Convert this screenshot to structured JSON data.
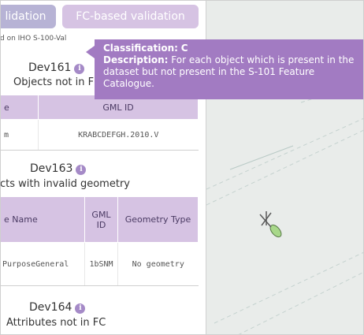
{
  "tabs": {
    "left_label": "lidation",
    "right_label": "FC-based validation"
  },
  "based_on": "d on IHO S-100-Val",
  "dev161": {
    "code": "Dev161",
    "subtitle": "Objects not in F",
    "headers": [
      "e",
      "GML ID"
    ],
    "rows": [
      [
        "m",
        "KRABCDEFGH.2010.V"
      ]
    ]
  },
  "dev163": {
    "code": "Dev163",
    "subtitle": "cts with invalid geometry",
    "headers": [
      "e Name",
      "GML ID",
      "Geometry Type"
    ],
    "rows": [
      [
        "PurposeGeneral",
        "1bSNM",
        "No geometry"
      ]
    ]
  },
  "dev164": {
    "code": "Dev164",
    "subtitle": "Attributes not in FC"
  },
  "tooltip": {
    "classification_label": "Classification:",
    "classification_value": "C",
    "description_label": "Description:",
    "description_value": "For each object which is present in the dataset but not present in the S-101 Feature Catalogue."
  },
  "colors": {
    "tab_left": "#b7b3d5",
    "tab_right": "#d6c3e3",
    "tooltip": "#a27bc2",
    "header": "#d6c3e3",
    "map": "#e9ecea"
  },
  "icons": [
    "info-icon",
    "buoy-icon"
  ]
}
